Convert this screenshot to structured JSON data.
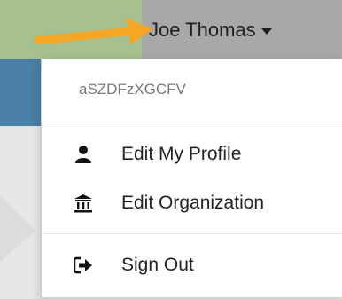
{
  "header": {
    "user_name": "Joe Thomas",
    "colors": {
      "green": "#a7c08f",
      "gray": "#a8a8a8",
      "arrow": "#f5a623"
    }
  },
  "menu": {
    "account_id": "aSZDFzXGCFV",
    "items": [
      {
        "label": "Edit My Profile",
        "icon": "user-icon"
      },
      {
        "label": "Edit Organization",
        "icon": "bank-icon"
      },
      {
        "label": "Sign Out",
        "icon": "sign-out-icon"
      }
    ]
  }
}
